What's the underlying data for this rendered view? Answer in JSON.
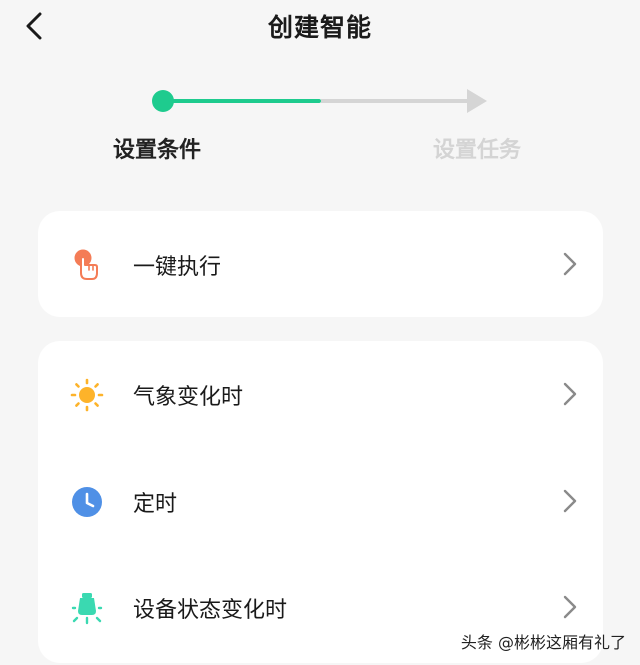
{
  "header": {
    "title": "创建智能",
    "back_icon": "chevron-left-icon"
  },
  "stepper": {
    "steps": [
      {
        "label": "设置条件",
        "state": "active"
      },
      {
        "label": "设置任务",
        "state": "inactive"
      }
    ],
    "progress": 0.5
  },
  "colors": {
    "accent": "#1ecb8e",
    "inactive": "#d4d4d4",
    "hand": "#f47c56",
    "sun": "#fdb32a",
    "clock": "#4f90e6",
    "bulb": "#3ad9b1"
  },
  "card_1": {
    "items": [
      {
        "label": "一键执行",
        "icon": "tap-hand-icon"
      }
    ]
  },
  "card_2": {
    "items": [
      {
        "label": "气象变化时",
        "icon": "sun-icon"
      },
      {
        "label": "定时",
        "icon": "clock-icon"
      },
      {
        "label": "设备状态变化时",
        "icon": "light-bulb-icon"
      }
    ]
  },
  "watermark": {
    "text": "头条 @彬彬这厢有礼了"
  }
}
